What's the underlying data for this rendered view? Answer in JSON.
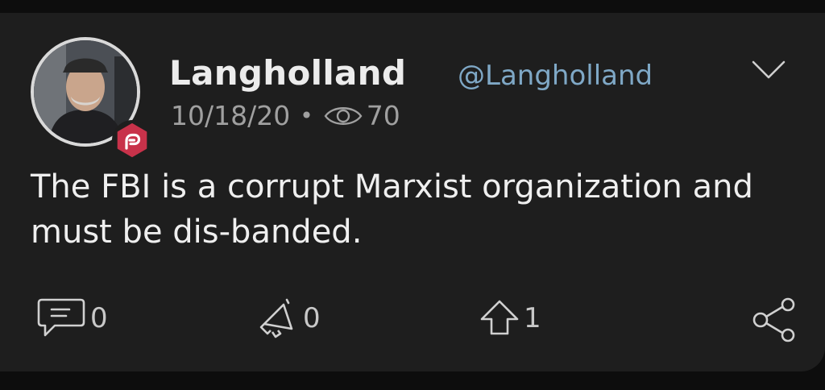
{
  "post": {
    "author": {
      "display_name": "Langholland",
      "handle": "@Langholland",
      "badge_icon": "parler-logo-icon"
    },
    "date": "10/18/20",
    "separator": "•",
    "views": "70",
    "text": "The FBI is a corrupt Marxist organization and must be dis-banded.",
    "actions": {
      "comments": {
        "icon": "comment-icon",
        "count": "0"
      },
      "echoes": {
        "icon": "echo-megaphone-icon",
        "count": "0"
      },
      "votes": {
        "icon": "upvote-arrow-icon",
        "count": "1"
      },
      "share": {
        "icon": "share-icon"
      }
    }
  },
  "colors": {
    "background": "#1e1e1e",
    "handle": "#7fa8c6",
    "badge": "#c8324a",
    "text": "#efefef"
  }
}
